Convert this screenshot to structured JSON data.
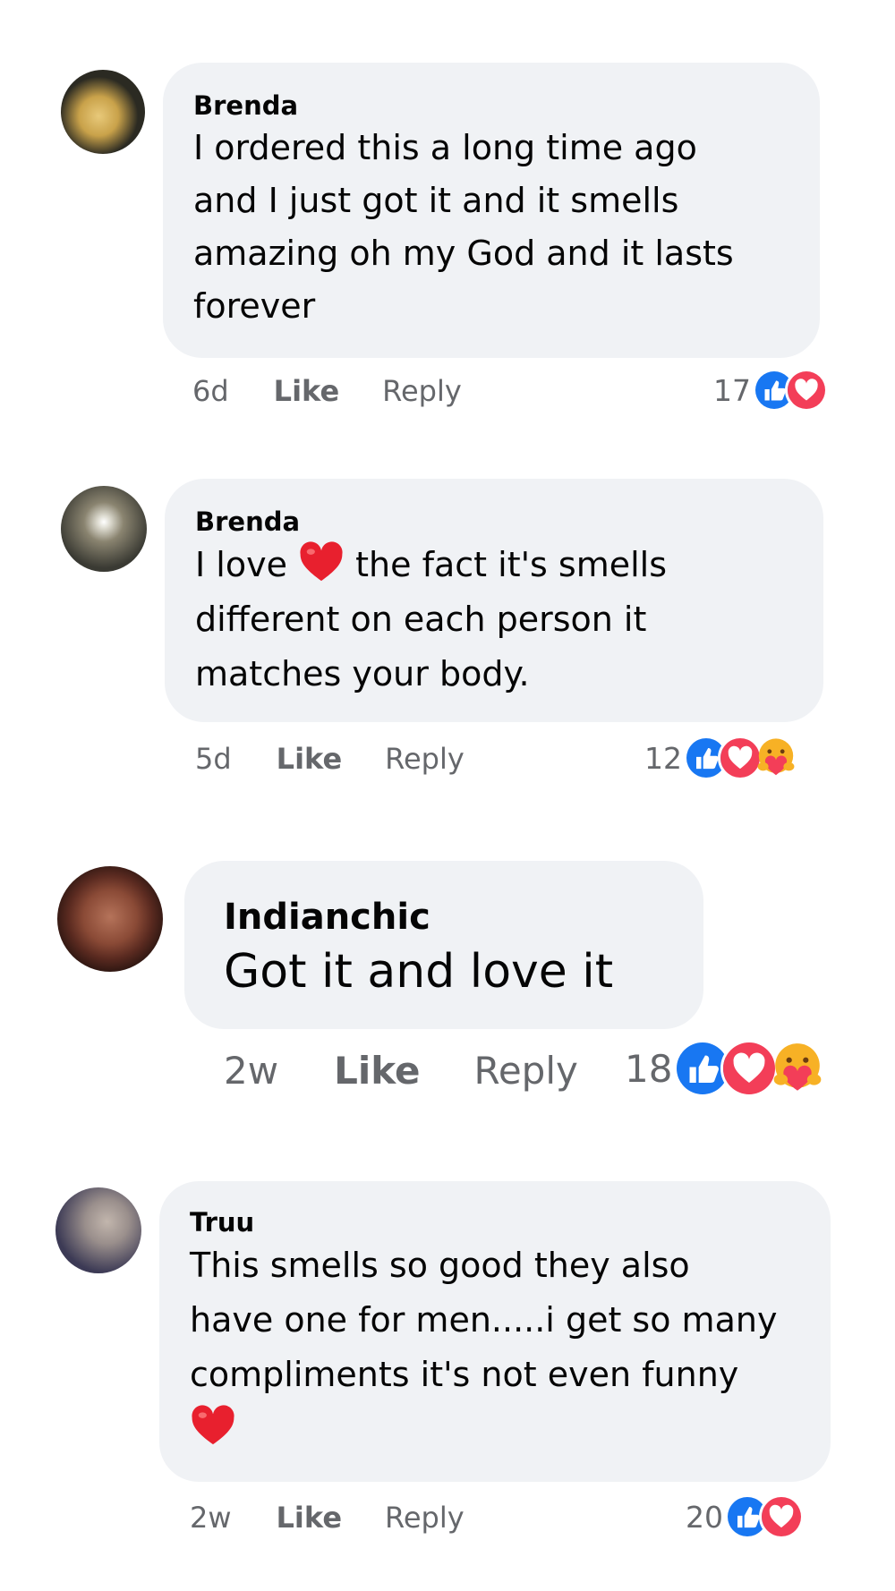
{
  "comments": [
    {
      "author": "Brenda",
      "lines": [
        "I ordered this a long time ago",
        "and I just got it and it smells",
        "amazing oh my God and it lasts",
        "forever"
      ],
      "time": "6d",
      "like_label": "Like",
      "reply_label": "Reply",
      "reaction_count": "17",
      "reactions": [
        "like-reaction",
        "love-reaction"
      ],
      "avatar_colors": [
        "#2b2a22",
        "#c9a24a",
        "#e8c97a"
      ]
    },
    {
      "author": "Brenda",
      "text_before_emoji": "I love",
      "text_after_emoji": "the fact it's smells",
      "lines": [
        "different on each person it",
        "matches your body."
      ],
      "inline_emoji": "red-heart-emoji",
      "time": "5d",
      "like_label": "Like",
      "reply_label": "Reply",
      "reaction_count": "12",
      "reactions": [
        "like-reaction",
        "love-reaction",
        "care-reaction"
      ],
      "avatar_colors": [
        "#3a3a33",
        "#8a8470",
        "#dcdacf"
      ]
    },
    {
      "author": "Indianchic",
      "lines": [
        "Got it and love it"
      ],
      "time": "2w",
      "like_label": "Like",
      "reply_label": "Reply",
      "reaction_count": "18",
      "reactions": [
        "like-reaction",
        "love-reaction",
        "care-reaction"
      ],
      "avatar_colors": [
        "#5a2a20",
        "#b5735a",
        "#1d0f0c"
      ]
    },
    {
      "author": "Truu",
      "lines": [
        "This smells so good they also",
        "have one for men.....i get so many",
        "compliments it's not even funny"
      ],
      "trailing_emoji": "red-heart-emoji",
      "time": "2w",
      "like_label": "Like",
      "reply_label": "Reply",
      "reaction_count": "20",
      "reactions": [
        "like-reaction",
        "love-reaction"
      ],
      "avatar_colors": [
        "#3c3a55",
        "#9a8f8c",
        "#c2b6ad"
      ]
    }
  ],
  "colors": {
    "bubble": "#f0f2f5",
    "meta_text": "#65676b",
    "like_blue": "#1877f2",
    "love_red": "#f33e58",
    "heart_red": "#e8202e"
  }
}
